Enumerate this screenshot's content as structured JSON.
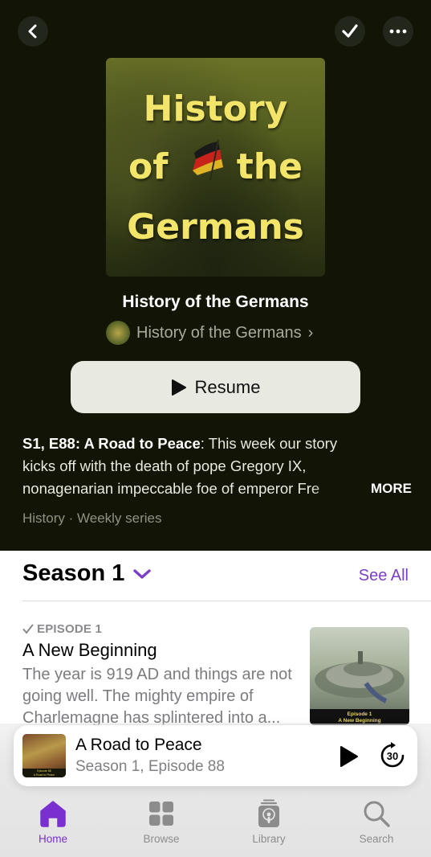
{
  "header": {
    "back_icon": "chevron-left-icon",
    "mark_played_icon": "checkmark-icon",
    "more_icon": "ellipsis-icon"
  },
  "artwork": {
    "line1": "History",
    "line2": "of the",
    "line3": "Germans"
  },
  "show": {
    "title": "History of the Germans",
    "publisher": "History of the Germans",
    "publisher_chevron": "›"
  },
  "resume_button": {
    "label": "Resume",
    "icon": "play-icon"
  },
  "description": {
    "episode_heading": "S1, E88: A Road to Peace",
    "line1_rest": ": This week our story",
    "line2": "kicks off with the death of pope Gregory IX,",
    "line3": "nonagenarian impeccable foe of emperor Fre",
    "more_label": "MORE"
  },
  "meta": {
    "genre_line": "History · Weekly series"
  },
  "season": {
    "title": "Season 1",
    "see_all_label": "See All",
    "accent": "#7a3ec8"
  },
  "episodes": [
    {
      "label": "EPISODE 1",
      "played_icon": "checkmark-icon",
      "title": "A New Beginning",
      "description": "The year is 919 AD and things are not going well. The mighty empire of Charlemagne has splintered into a...",
      "thumb_caption_line1": "Episode 1",
      "thumb_caption_line2": "A New Beginning"
    }
  ],
  "mini_player": {
    "title": "A Road to Peace",
    "subtitle": "Season 1, Episode 88",
    "art_caption_line1": "Episode 88",
    "art_caption_line2": "A Road to Peace",
    "skip_seconds": "30"
  },
  "tabbar": {
    "active_color": "#7a2fd1",
    "items": [
      {
        "label": "Home",
        "icon": "house-icon",
        "active": true
      },
      {
        "label": "Browse",
        "icon": "grid-icon",
        "active": false
      },
      {
        "label": "Library",
        "icon": "podcast-library-icon",
        "active": false
      },
      {
        "label": "Search",
        "icon": "magnifying-glass-icon",
        "active": false
      }
    ]
  }
}
